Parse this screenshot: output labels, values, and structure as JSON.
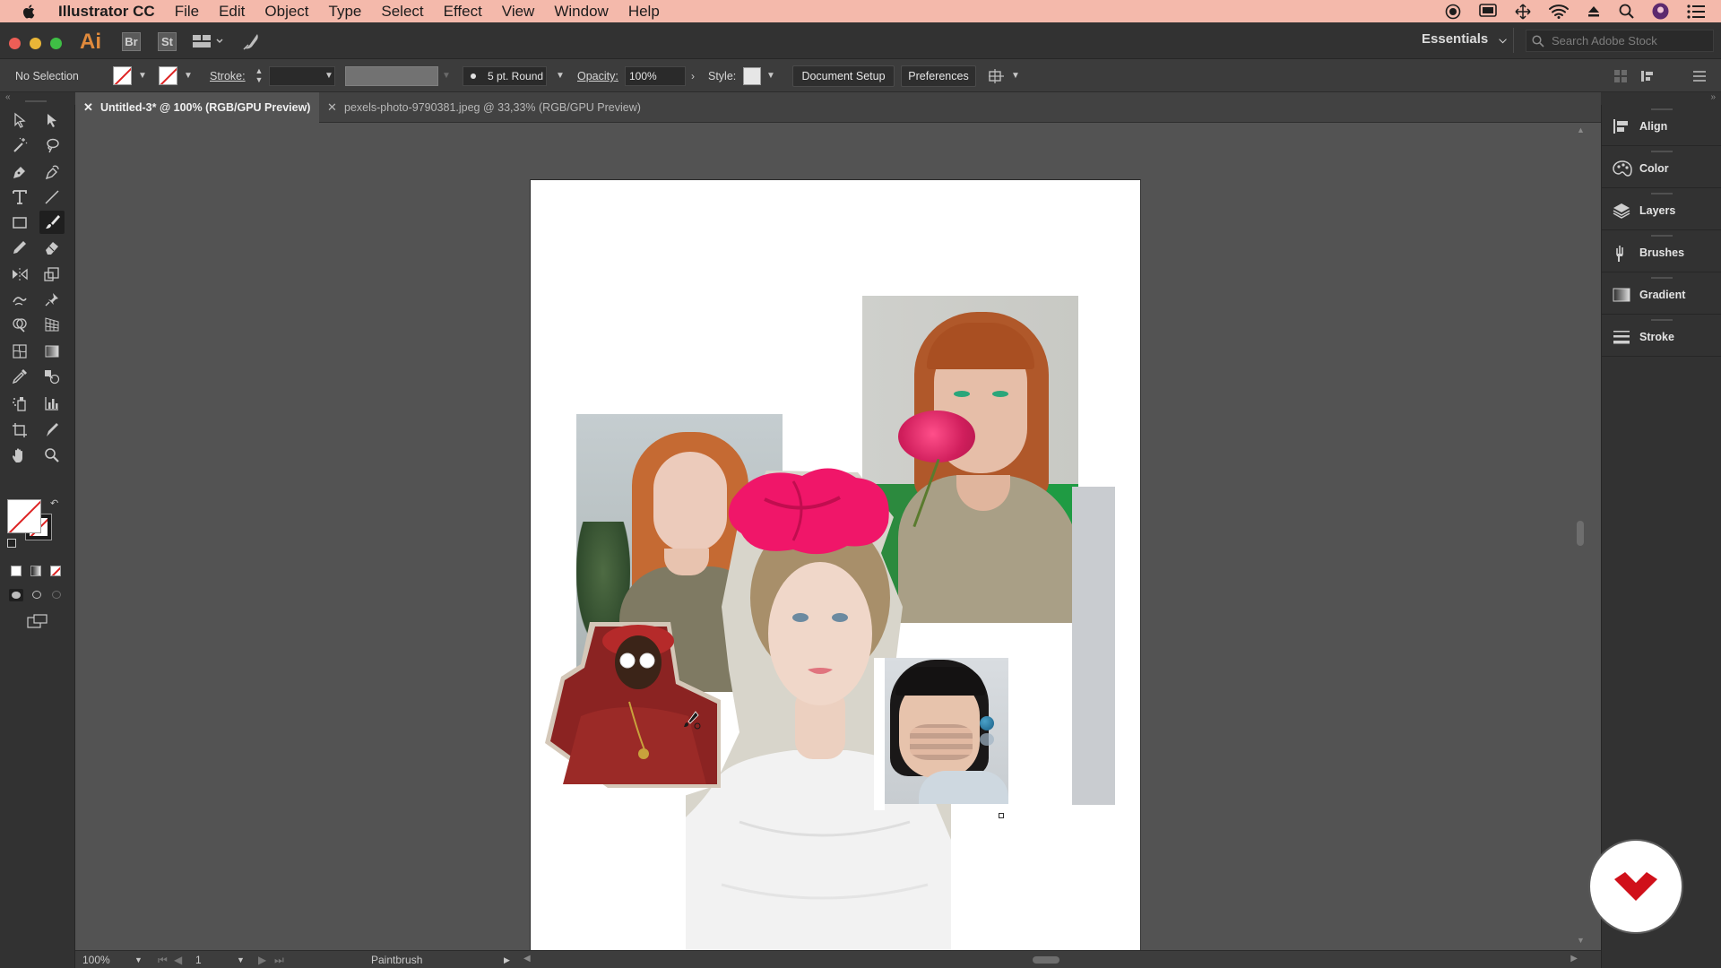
{
  "menubar": {
    "app": "Illustrator CC",
    "items": [
      "File",
      "Edit",
      "Object",
      "Type",
      "Select",
      "Effect",
      "View",
      "Window",
      "Help"
    ]
  },
  "appbar": {
    "bridge_label": "Br",
    "stock_label": "St",
    "workspace": "Essentials",
    "stock_search_placeholder": "Search Adobe Stock"
  },
  "control": {
    "selection": "No Selection",
    "stroke_label": "Stroke:",
    "brush": "5 pt. Round",
    "opacity_label": "Opacity:",
    "opacity_value": "100%",
    "style_label": "Style:",
    "document_setup": "Document Setup",
    "preferences": "Preferences"
  },
  "tabs": [
    {
      "label": "Untitled-3* @ 100% (RGB/GPU Preview)",
      "active": true
    },
    {
      "label": "pexels-photo-9790381.jpeg @ 33,33% (RGB/GPU Preview)",
      "active": false
    }
  ],
  "panels": [
    "Align",
    "Color",
    "Layers",
    "Brushes",
    "Gradient",
    "Stroke"
  ],
  "status": {
    "zoom": "100%",
    "artboard": "1",
    "tool": "Paintbrush"
  },
  "colors": {
    "menubar_bg": "#f4b9ab",
    "panel_bg": "#323232",
    "canvas_bg": "#535353",
    "accent_badge": "#d0101a"
  }
}
